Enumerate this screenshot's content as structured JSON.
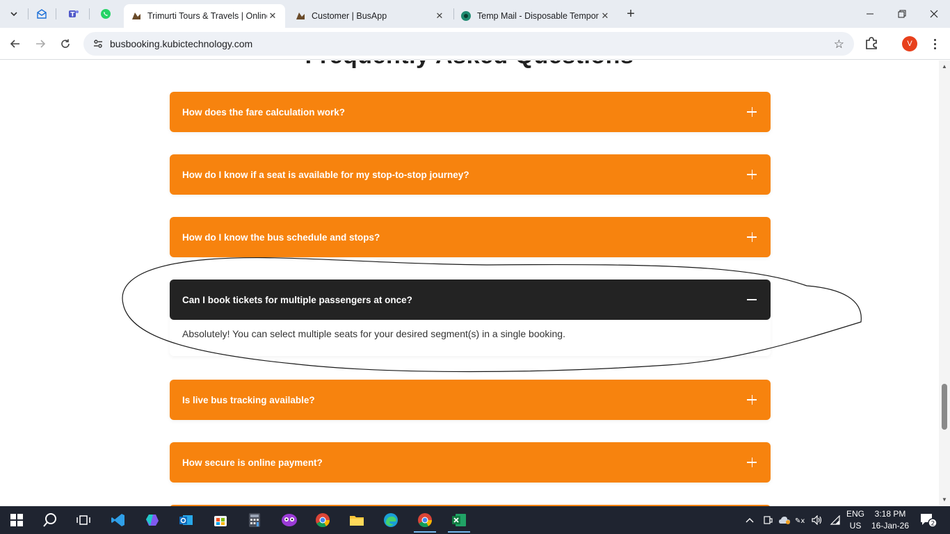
{
  "browser": {
    "tabs": [
      {
        "title": "Trimurti Tours & Travels | Online",
        "active": true,
        "favicon": "bus-logo-icon"
      },
      {
        "title": "Customer | BusApp",
        "active": false,
        "favicon": "bus-logo-icon"
      },
      {
        "title": "Temp Mail - Disposable Tempor",
        "active": false,
        "favicon": "temp-mail-icon"
      }
    ],
    "url": "busbooking.kubictechnology.com",
    "profile_initial": "V"
  },
  "page": {
    "heading": "Frequently Asked Questions",
    "accent_color": "#f7830e",
    "open_color": "#232323",
    "faqs": [
      {
        "question": "How does the fare calculation work?",
        "open": false
      },
      {
        "question": "How do I know if a seat is available for my stop-to-stop journey?",
        "open": false
      },
      {
        "question": "How do I know the bus schedule and stops?",
        "open": false
      },
      {
        "question": "Can I book tickets for multiple passengers at once?",
        "open": true,
        "answer": "Absolutely! You can select multiple seats for your desired segment(s) in a single booking."
      },
      {
        "question": "Is live bus tracking available?",
        "open": false
      },
      {
        "question": "How secure is online payment?",
        "open": false
      }
    ]
  },
  "taskbar": {
    "lang_top": "ENG",
    "lang_bottom": "US",
    "time": "3:18 PM",
    "date": "16-Jan-26",
    "notification_count": "2"
  }
}
